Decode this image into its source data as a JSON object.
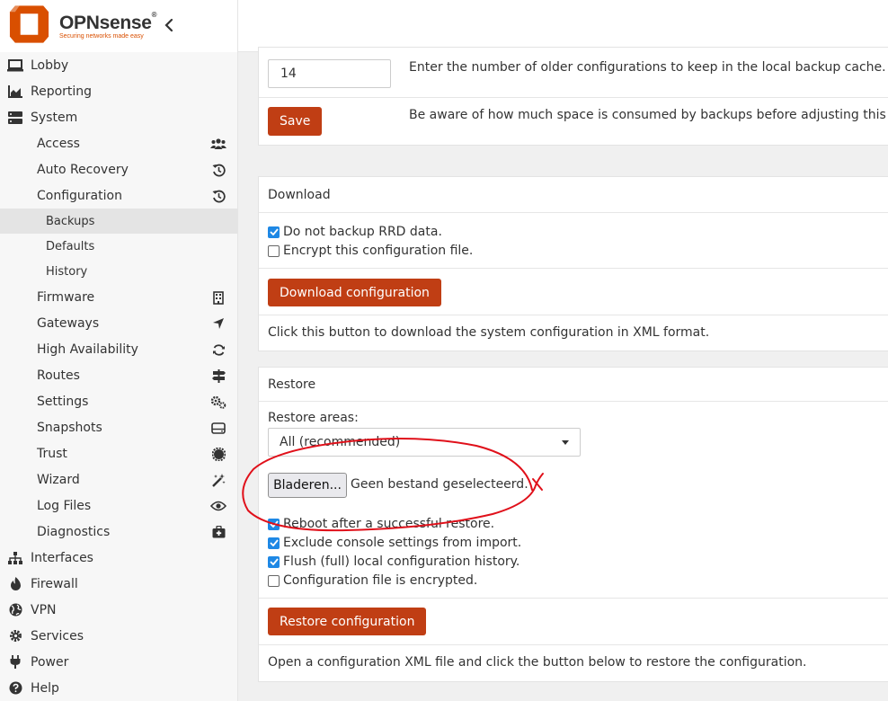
{
  "brand": {
    "name": "OPNsense",
    "registered": "®",
    "tagline": "Securing networks made easy"
  },
  "sidebar": {
    "top_items": [
      {
        "label": "Lobby",
        "icon": "laptop-icon"
      },
      {
        "label": "Reporting",
        "icon": "area-chart-icon"
      },
      {
        "label": "System",
        "icon": "server-icon"
      }
    ],
    "system_children": [
      {
        "label": "Access",
        "icon": "users-icon"
      },
      {
        "label": "Auto Recovery",
        "icon": "history-icon"
      },
      {
        "label": "Configuration",
        "icon": "history-icon"
      }
    ],
    "configuration_children": [
      {
        "label": "Backups",
        "active": true
      },
      {
        "label": "Defaults"
      },
      {
        "label": "History"
      }
    ],
    "system_children_after": [
      {
        "label": "Firmware",
        "icon": "building-icon"
      },
      {
        "label": "Gateways",
        "icon": "location-arrow-icon"
      },
      {
        "label": "High Availability",
        "icon": "refresh-icon"
      },
      {
        "label": "Routes",
        "icon": "signs-icon"
      },
      {
        "label": "Settings",
        "icon": "cogs-icon"
      },
      {
        "label": "Snapshots",
        "icon": "hdd-icon"
      },
      {
        "label": "Trust",
        "icon": "certificate-icon"
      },
      {
        "label": "Wizard",
        "icon": "magic-icon"
      },
      {
        "label": "Log Files",
        "icon": "eye-icon"
      },
      {
        "label": "Diagnostics",
        "icon": "medkit-icon"
      }
    ],
    "bottom_items": [
      {
        "label": "Interfaces",
        "icon": "sitemap-icon"
      },
      {
        "label": "Firewall",
        "icon": "fire-icon"
      },
      {
        "label": "VPN",
        "icon": "globe-icon"
      },
      {
        "label": "Services",
        "icon": "cog-icon"
      },
      {
        "label": "Power",
        "icon": "plug-icon"
      },
      {
        "label": "Help",
        "icon": "question-icon"
      }
    ]
  },
  "backup_count": {
    "value": "14",
    "help": "Enter the number of older configurations to keep in the local backup cache.",
    "save_label": "Save",
    "save_help": "Be aware of how much space is consumed by backups before adjusting this value. Curr"
  },
  "download": {
    "title": "Download",
    "options": [
      {
        "label": "Do not backup RRD data.",
        "checked": true
      },
      {
        "label": "Encrypt this configuration file.",
        "checked": false
      }
    ],
    "button_label": "Download configuration",
    "help": "Click this button to download the system configuration in XML format."
  },
  "restore": {
    "title": "Restore",
    "areas_label": "Restore areas:",
    "areas_value": "All (recommended)",
    "file_button": "Bladeren...",
    "file_status": "Geen bestand geselecteerd.",
    "options": [
      {
        "label": "Reboot after a successful restore.",
        "checked": true
      },
      {
        "label": "Exclude console settings from import.",
        "checked": true
      },
      {
        "label": "Flush (full) local configuration history.",
        "checked": true
      },
      {
        "label": "Configuration file is encrypted.",
        "checked": false
      }
    ],
    "button_label": "Restore configuration",
    "help": "Open a configuration XML file and click the button below to restore the configuration."
  },
  "colors": {
    "accent": "#c03e14",
    "checkbox": "#1e88e5",
    "annotation": "#e0101a",
    "logo": "#d94f00"
  }
}
